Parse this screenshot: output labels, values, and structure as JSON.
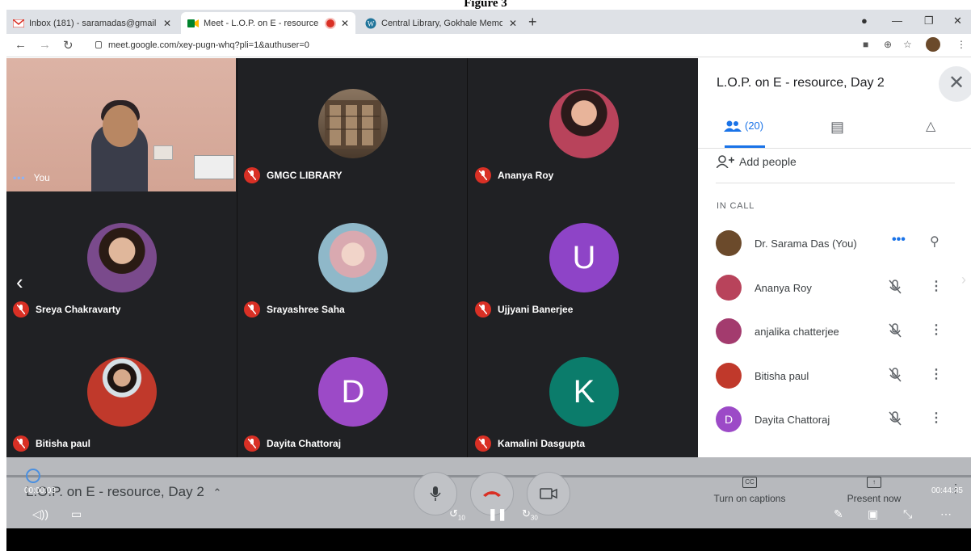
{
  "figure_caption": "Figure 3",
  "browser": {
    "tabs": [
      {
        "label": "Inbox (181) - saramadas@gmail.c",
        "active": false
      },
      {
        "label": "Meet - L.O.P. on E - resource",
        "active": true
      },
      {
        "label": "Central Library, Gokhale Memori",
        "active": false
      }
    ],
    "url": "meet.google.com/xey-pugn-whq?pli=1&authuser=0"
  },
  "grid": {
    "tiles": [
      {
        "name": "You",
        "type": "video"
      },
      {
        "name": "GMGC LIBRARY",
        "type": "photo",
        "muted": true,
        "color": "#6b5b4a"
      },
      {
        "name": "Ananya Roy",
        "type": "photo",
        "muted": true,
        "color": "#b8435b"
      },
      {
        "name": "Sreya Chakravarty",
        "type": "photo",
        "muted": true,
        "color": "#7a4a8c"
      },
      {
        "name": "Srayashree Saha",
        "type": "photo",
        "muted": true,
        "color": "#c9a2a8"
      },
      {
        "name": "Ujjyani Banerjee",
        "type": "letter",
        "letter": "U",
        "muted": true,
        "color": "#8e44c7"
      },
      {
        "name": "Bitisha paul",
        "type": "photo",
        "muted": true,
        "color": "#c0392b"
      },
      {
        "name": "Dayita Chattoraj",
        "type": "letter",
        "letter": "D",
        "muted": true,
        "color": "#9c4ac7"
      },
      {
        "name": "Kamalini Dasgupta",
        "type": "letter",
        "letter": "K",
        "muted": true,
        "color": "#0b7c6b"
      }
    ]
  },
  "panel": {
    "title": "L.O.P. on E - resource, Day 2",
    "people_count": "(20)",
    "add_people": "Add people",
    "section": "IN CALL",
    "participants": [
      {
        "name": "Dr. Sarama Das (You)",
        "avatar_color": "#6b4a2b",
        "status": "speaking"
      },
      {
        "name": "Ananya Roy",
        "avatar_color": "#b8435b",
        "status": "muted"
      },
      {
        "name": "anjalika chatterjee",
        "avatar_color": "#a33b6e",
        "status": "muted"
      },
      {
        "name": "Bitisha paul",
        "avatar_color": "#c0392b",
        "status": "muted"
      },
      {
        "name": "Dayita Chattoraj",
        "avatar_letter": "D",
        "avatar_color": "#9c4ac7",
        "status": "muted"
      }
    ]
  },
  "player": {
    "meeting_title": "L.O.P. on E - resource, Day 2",
    "current_time": "00:00:03",
    "total_time": "00:44:35",
    "captions_label": "Turn on captions",
    "present_label": "Present now",
    "skip_back": "10",
    "skip_forward": "30"
  }
}
